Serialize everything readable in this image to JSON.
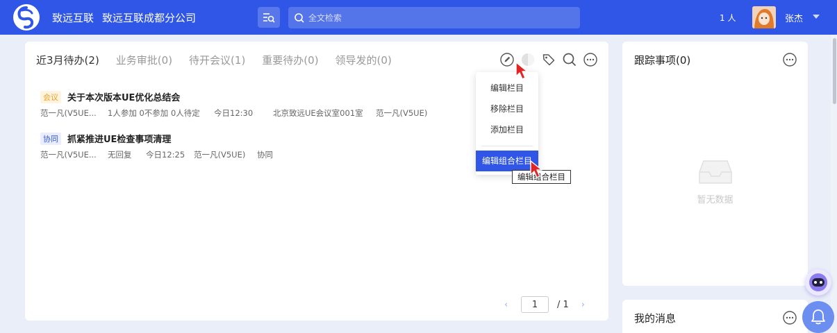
{
  "header": {
    "company_short": "致远互联",
    "company_full": "致远互联成都分公司",
    "search_placeholder": "全文检索",
    "online_count": "1 人",
    "username": "张杰"
  },
  "main_panel": {
    "tabs": [
      {
        "label": "近3月待办(2)",
        "active": true
      },
      {
        "label": "业务审批(0)",
        "active": false
      },
      {
        "label": "待开会议(1)",
        "active": false
      },
      {
        "label": "重要待办(0)",
        "active": false
      },
      {
        "label": "领导发的(0)",
        "active": false
      }
    ],
    "items": [
      {
        "tag": "会议",
        "title": "关于本次版本UE优化总结会",
        "meta": [
          "范一凡(V5UE...",
          "1人参加 0不参加 0人待定",
          "今日12:30",
          "北京致远UE会议室001室",
          "范一凡(V5UE)"
        ]
      },
      {
        "tag": "协同",
        "title": "抓紧推进UE检查事项清理",
        "meta": [
          "范一凡(V5UE...",
          "无回复",
          "今日12:25",
          "范一凡(V5UE)",
          "协同"
        ]
      }
    ],
    "pager": {
      "current": "1",
      "total": "/ 1"
    }
  },
  "dropdown": {
    "items": [
      "编辑栏目",
      "移除栏目",
      "添加栏目"
    ],
    "highlight": "编辑组合栏目",
    "tooltip": "编辑组合栏目"
  },
  "track_panel": {
    "title": "跟踪事项(0)",
    "empty_text": "暂无数据"
  },
  "message_panel": {
    "title": "我的消息"
  },
  "colors": {
    "primary": "#2f56e6",
    "meeting_tag": "#f0a020",
    "collab_tag": "#3a5bd9"
  }
}
